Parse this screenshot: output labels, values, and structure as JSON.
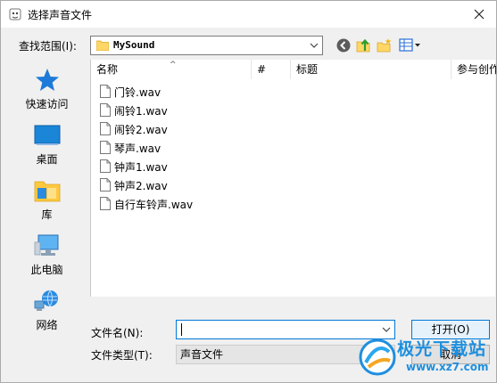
{
  "window": {
    "title": "选择声音文件"
  },
  "toolbar": {
    "lookin_label": "查找范围(I):",
    "lookin_value": "MySound"
  },
  "places": [
    {
      "label": "快速访问"
    },
    {
      "label": "桌面"
    },
    {
      "label": "库"
    },
    {
      "label": "此电脑"
    },
    {
      "label": "网络"
    }
  ],
  "list": {
    "columns": [
      "名称",
      "#",
      "标题",
      "参与创作"
    ],
    "files": [
      "门铃.wav",
      "闹铃1.wav",
      "闹铃2.wav",
      "琴声.wav",
      "钟声1.wav",
      "钟声2.wav",
      "自行车铃声.wav"
    ]
  },
  "fields": {
    "filename_label": "文件名(N):",
    "filename_value": "",
    "filetype_label": "文件类型(T):",
    "filetype_value": "声音文件"
  },
  "buttons": {
    "open": "打开(O)",
    "cancel": "取消"
  },
  "watermark": {
    "text": "极光下载站",
    "url": "www.xz7.com"
  }
}
